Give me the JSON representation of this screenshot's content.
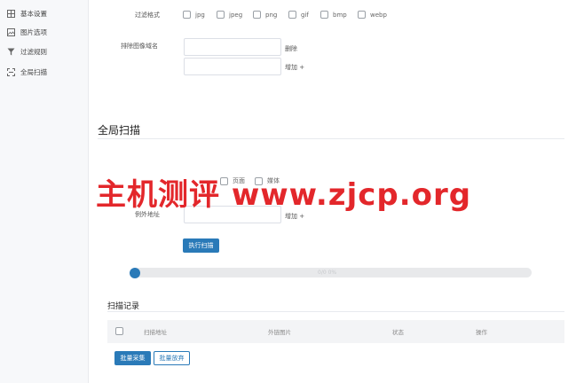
{
  "sidebar": {
    "items": [
      {
        "label": "基本设置",
        "icon": "grid-icon"
      },
      {
        "label": "图片选项",
        "icon": "image-icon"
      },
      {
        "label": "过滤规则",
        "icon": "filter-icon"
      },
      {
        "label": "全局扫描",
        "icon": "scan-icon"
      }
    ]
  },
  "filter": {
    "format_label": "过滤格式",
    "formats": [
      "jpg",
      "jpeg",
      "png",
      "gif",
      "bmp",
      "webp"
    ],
    "exclude_domain_label": "排除图像域名",
    "delete_label": "删除",
    "add_label": "增加 +"
  },
  "global_scan": {
    "title": "全局扫描",
    "scan_types": [
      "页面",
      "媒体"
    ],
    "exception_label": "例外地址",
    "add_label": "增加 +",
    "run_button": "执行扫描",
    "progress_text": "0/0 0%",
    "progress": 0.0
  },
  "records": {
    "title": "扫描记录",
    "columns": [
      "扫描地址",
      "外链图片",
      "状态",
      "操作"
    ],
    "batch_collect": "批量采集",
    "batch_abandon": "批量放弃"
  },
  "watermark": "主机测评 www.zjcp.org",
  "colors": {
    "accent": "#2a7ab8",
    "watermark": "#e3272b"
  }
}
